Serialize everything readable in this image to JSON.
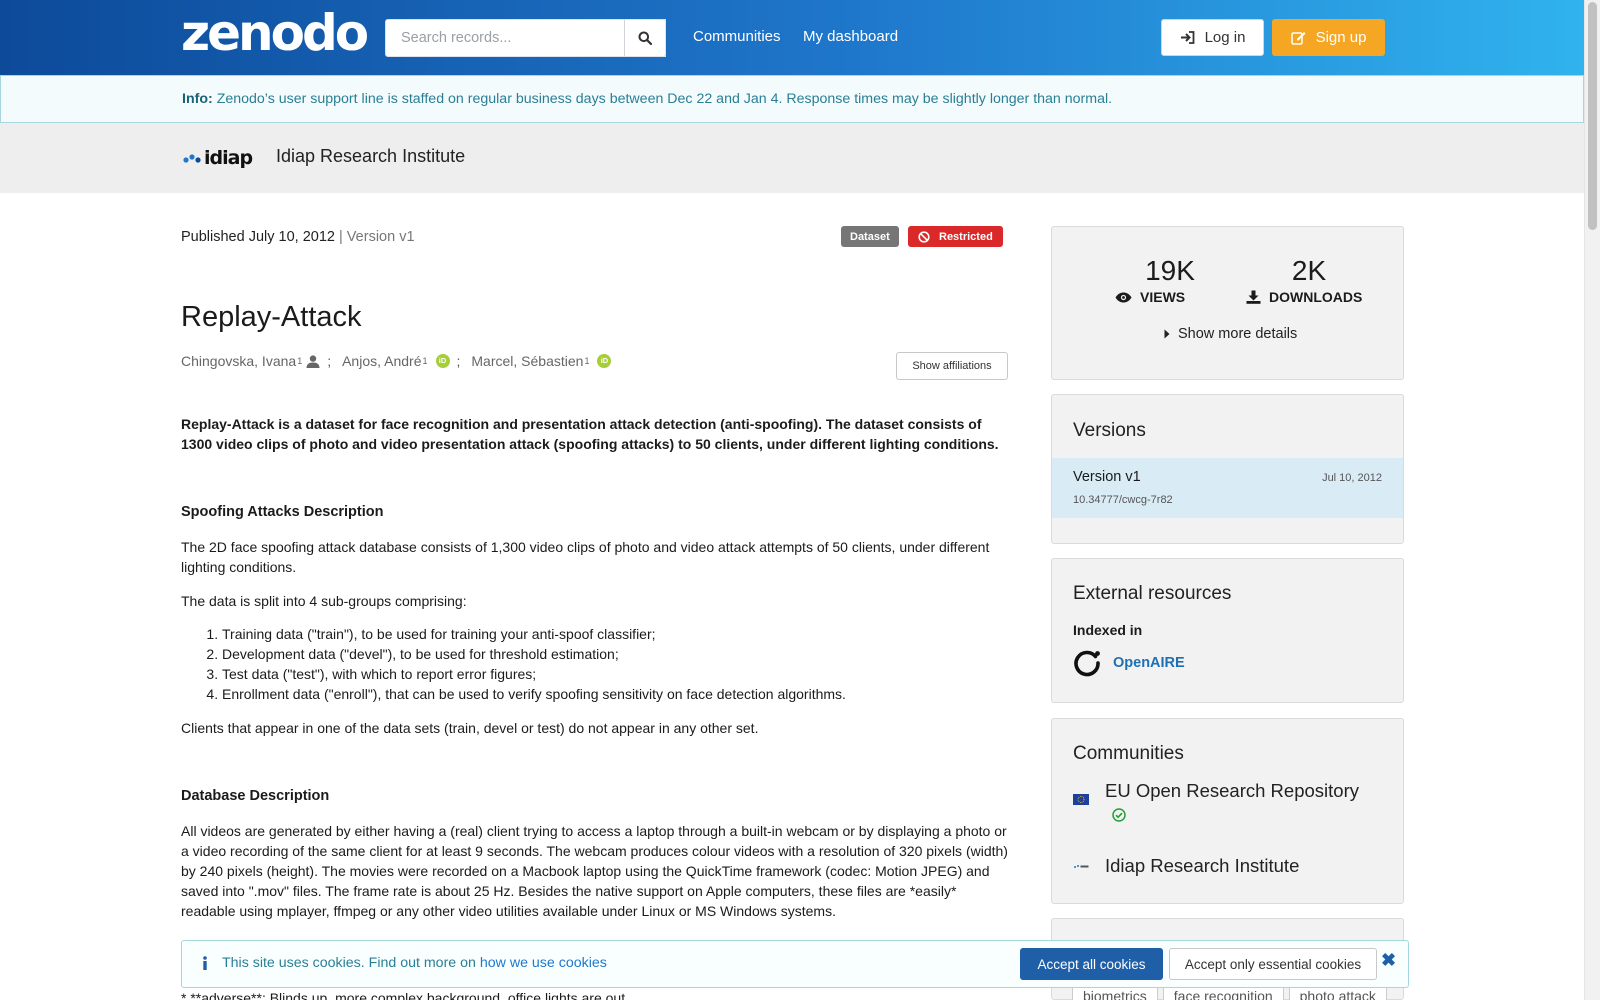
{
  "header": {
    "logo_text": "zenodo",
    "search_placeholder": "Search records...",
    "nav": [
      "Communities",
      "My dashboard"
    ],
    "login_label": "Log in",
    "signup_label": "Sign up"
  },
  "info_banner": {
    "prefix": "Info:",
    "message": "Zenodo’s user support line is staffed on regular business days between Dec 22 and Jan 4. Response times may be slightly longer than normal."
  },
  "community": {
    "logo_text": "idiap",
    "name": "Idiap Research Institute"
  },
  "record": {
    "published": "Published July 10, 2012",
    "version": "| Version v1",
    "badge_type": "Dataset",
    "badge_access": "Restricted",
    "title": "Replay-Attack",
    "creators": [
      {
        "name": "Chingovska, Ivana",
        "aff": "1"
      },
      {
        "name": "Anjos, André",
        "aff": "1"
      },
      {
        "name": "Marcel, Sébastien",
        "aff": "1"
      }
    ],
    "show_affiliations": "Show affiliations",
    "abstract": "Replay-Attack is a dataset for face recognition and presentation attack detection (anti-spoofing). The dataset consists of 1300 video clips of photo and video presentation attack (spoofing attacks) to 50 clients, under different lighting conditions.",
    "section1_title": "Spoofing Attacks Description",
    "section1_p1": "The 2D face spoofing attack database consists of 1,300 video clips of photo and video attack attempts of 50 clients, under different lighting conditions.",
    "section1_p2": "The data is split into 4 sub-groups comprising:",
    "section1_list": [
      "Training data (\"train\"), to be used for training your anti-spoof classifier;",
      "Development data (\"devel\"), to be used for threshold estimation;",
      "Test data (\"test\"), with which to report error figures;",
      "Enrollment data (\"enroll\"), that can be used to verify spoofing sensitivity on face detection algorithms."
    ],
    "section1_p3": "Clients that appear in one of the data sets (train, devel or test) do not appear in any other set.",
    "section2_title": "Database Description",
    "section2_p1": "All videos are generated by either having a (real) client trying to access a laptop through a built-in webcam or by displaying a photo or a video recording of the same client for at least 9 seconds. The webcam produces colour videos with a resolution of 320 pixels (width) by 240 pixels (height). The movies were recorded on a Macbook laptop using the QuickTime framework (codec: Motion JPEG) and saved into \".mov\" files. The frame rate is about 25 Hz. Besides the native support on Apple computers, these files are *easily* readable using mplayer, ffmpeg or any other video utilities available under Linux or MS Windows systems.",
    "partial_line": "* **adverse**: Blinds up, more complex background, office lights are out"
  },
  "sidebar": {
    "views_count": "19K",
    "views_label": "VIEWS",
    "downloads_count": "2K",
    "downloads_label": "DOWNLOADS",
    "show_more": "Show more details",
    "versions_title": "Versions",
    "version_name": "Version v1",
    "version_date": "Jul 10, 2012",
    "version_doi": "10.34777/cwcg-7r82",
    "external_title": "External resources",
    "indexed_in": "Indexed in",
    "openaire": "OpenAIRE",
    "communities_title": "Communities",
    "communities": [
      "EU Open Research Repository",
      "Idiap Research Institute"
    ],
    "keywords": [
      "biometrics",
      "face recognition",
      "photo attack"
    ]
  },
  "cookie": {
    "message": "This site uses cookies. Find out more on",
    "link": "how we use cookies",
    "accept_all": "Accept all cookies",
    "accept_essential": "Accept only essential cookies"
  },
  "colors": {
    "header_start": "#0d4a9a",
    "header_end": "#30b3ee",
    "signup": "#f5a623",
    "restricted": "#db2828",
    "orcid": "#a6ce39",
    "openaire_link": "#1f6fb5"
  }
}
